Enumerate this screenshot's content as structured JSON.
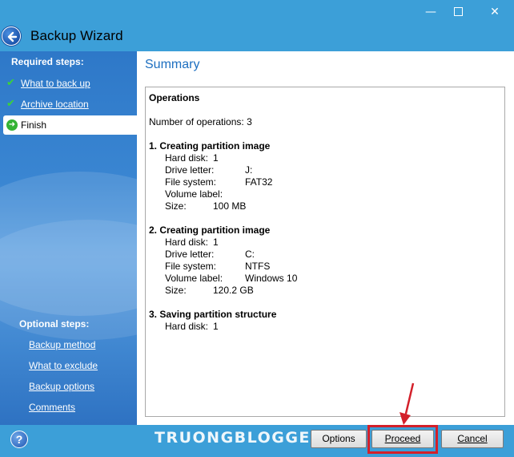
{
  "window": {
    "title": "Backup Wizard",
    "controls": {
      "minimize": "—",
      "close": "✕"
    }
  },
  "sidebar": {
    "required_heading": "Required steps:",
    "required_items": [
      {
        "label": "What to back up",
        "state": "done"
      },
      {
        "label": "Archive location",
        "state": "done"
      },
      {
        "label": "Finish",
        "state": "current"
      }
    ],
    "optional_heading": "Optional steps:",
    "optional_items": [
      {
        "label": "Backup method"
      },
      {
        "label": "What to exclude"
      },
      {
        "label": "Backup options"
      },
      {
        "label": "Comments"
      }
    ]
  },
  "main": {
    "title": "Summary",
    "operations_heading": "Operations",
    "number_of_operations": "Number of operations: 3",
    "operations": [
      {
        "heading": "1. Creating partition image",
        "fields": [
          {
            "label": "Hard disk:",
            "value": "1"
          },
          {
            "label": "Drive letter:",
            "value": "J:"
          },
          {
            "label": "File system:",
            "value": "FAT32"
          },
          {
            "label": "Volume label:",
            "value": ""
          },
          {
            "label": "Size:",
            "value": "100 MB"
          }
        ]
      },
      {
        "heading": "2. Creating partition image",
        "fields": [
          {
            "label": "Hard disk:",
            "value": "1"
          },
          {
            "label": "Drive letter:",
            "value": "C:"
          },
          {
            "label": "File system:",
            "value": "NTFS"
          },
          {
            "label": "Volume label:",
            "value": "Windows 10"
          },
          {
            "label": "Size:",
            "value": "120.2 GB"
          }
        ]
      },
      {
        "heading": "3. Saving partition structure",
        "fields": [
          {
            "label": "Hard disk:",
            "value": "1"
          }
        ]
      }
    ]
  },
  "footer": {
    "help_label": "?",
    "watermark": "TRUONGBLOGGER",
    "options_label": "Options",
    "proceed_label": "Proceed",
    "cancel_label": "Cancel"
  },
  "colors": {
    "titlebar": "#3c9fd8",
    "accent": "#1d6fc0",
    "highlight": "#d3202a"
  }
}
